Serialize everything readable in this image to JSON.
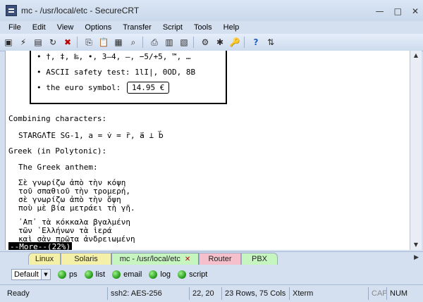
{
  "window": {
    "title": "mc - /usr/local/etc - SecureCRT",
    "minimize": "—",
    "maximize": "□",
    "close": "✕"
  },
  "menu": [
    "File",
    "Edit",
    "View",
    "Options",
    "Transfer",
    "Script",
    "Tools",
    "Help"
  ],
  "toolbar": {
    "icons": [
      "connect-icon",
      "quick-connect-icon",
      "connect-tab-icon",
      "reconnect-icon",
      "disconnect-icon",
      "copy-icon",
      "paste-icon",
      "copy-paste-icon",
      "find-icon",
      "print-icon",
      "print-selection-icon",
      "print-setup-icon",
      "session-options-icon",
      "global-options-icon",
      "keymap-icon",
      "help-icon",
      "sftp-icon"
    ],
    "glyphs": [
      "▣",
      "⚡",
      "▤",
      "↻",
      "✖",
      "⎘",
      "📋",
      "▦",
      "⌕",
      "⎙",
      "▥",
      "▧",
      "⚙",
      "✱",
      "🔑",
      "?",
      "⇅"
    ]
  },
  "terminal": {
    "lines": [
      "• †, ‡, ‰, •, 3–4, —, −5/+5, ™, …",
      "• ASCII safety test: 1lI|, 0OD, 8B",
      "• the euro symbol:",
      "Combining characters:",
      "STARGΛ̊TE SG-1, a = v̇ = r̈, a⃑ ⊥ b⃑",
      "Greek (in Polytonic):",
      "The Greek anthem:",
      "Σὲ γνωρίζω ἀπὸ τὴν κόψη",
      "τοῦ σπαθιοῦ τὴν τρομερή,",
      "σὲ γνωρίζω ἀπὸ τὴν ὄψη",
      "ποὺ μὲ βία μετράει τὴ γῆ.",
      "᾿Απ᾿ τὰ κόκκαλα βγαλμένη",
      "τῶν ῾Ελλήνων τὰ ἱερά",
      "καὶ σὰν πρῶτα ἀνδρειωμένη"
    ],
    "euro_value": "14.95 €",
    "more_prompt": "--More--(22%)"
  },
  "tabs": [
    {
      "label": "Linux",
      "color": "#f5f0a8",
      "active": false
    },
    {
      "label": "Solaris",
      "color": "#f5f0a8",
      "active": false
    },
    {
      "label": "mc - /usr/local/etc",
      "color": "#c6f5c0",
      "active": true
    },
    {
      "label": "Router",
      "color": "#f5c0cc",
      "active": false
    },
    {
      "label": "PBX",
      "color": "#c6f5c0",
      "active": false
    }
  ],
  "tab_close": "✕",
  "tab_scroll": "▶",
  "button_bar": {
    "selected": "Default",
    "buttons": [
      "ps",
      "list",
      "email",
      "log",
      "script"
    ]
  },
  "status": {
    "ready": "Ready",
    "session": "ssh2: AES-256",
    "cursor": "22, 20",
    "size": "23 Rows, 75 Cols",
    "terminal": "Xterm",
    "cap": "CAP",
    "num": "NUM"
  }
}
